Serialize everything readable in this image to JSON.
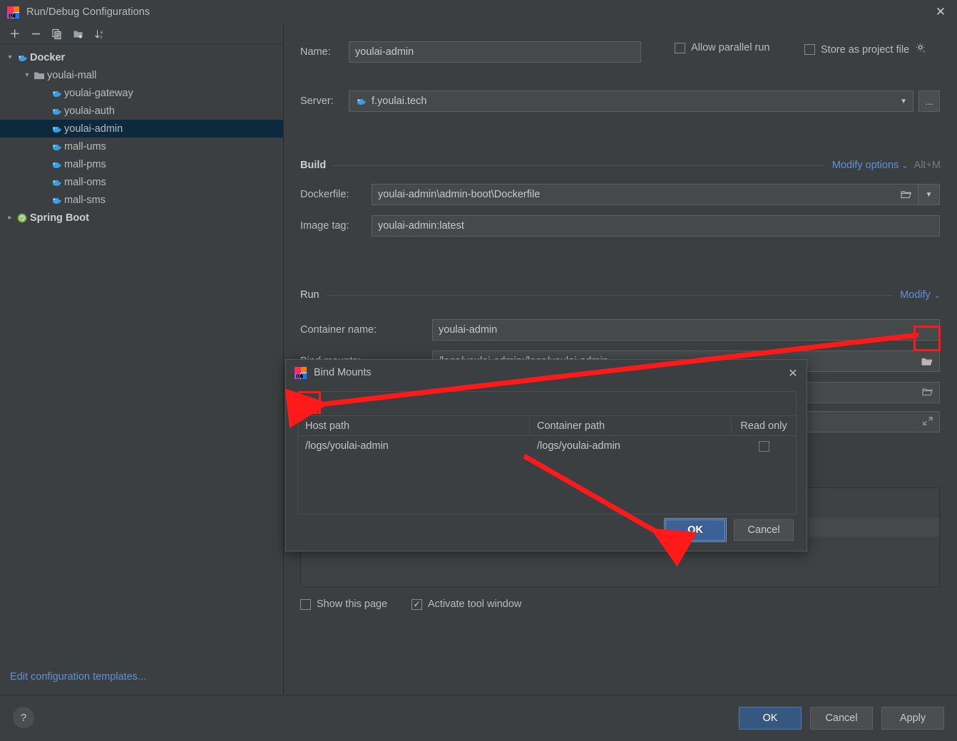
{
  "window": {
    "title": "Run/Debug Configurations",
    "app_icon": "intellij-idea-icon",
    "close_label": "✕"
  },
  "sidebar": {
    "toolbar": [
      {
        "name": "add-configuration-button",
        "icon": "plus-icon",
        "label": "+"
      },
      {
        "name": "remove-configuration-button",
        "icon": "minus-icon",
        "label": "−"
      },
      {
        "name": "copy-configuration-button",
        "icon": "copy-icon",
        "label": ""
      },
      {
        "name": "new-folder-button",
        "icon": "new-folder-icon",
        "label": ""
      },
      {
        "name": "sort-configurations-button",
        "icon": "sort-alphabetically-icon",
        "label": ""
      }
    ],
    "tree": [
      {
        "label": "Docker",
        "icon": "docker-icon",
        "level": 0,
        "expanded": true,
        "bold": true,
        "selected": false
      },
      {
        "label": "youlai-mall",
        "icon": "folder-icon",
        "level": 1,
        "expanded": true,
        "bold": false,
        "selected": false
      },
      {
        "label": "youlai-gateway",
        "icon": "docker-icon",
        "level": 2,
        "expanded": null,
        "bold": false,
        "selected": false
      },
      {
        "label": "youlai-auth",
        "icon": "docker-icon",
        "level": 2,
        "expanded": null,
        "bold": false,
        "selected": false
      },
      {
        "label": "youlai-admin",
        "icon": "docker-icon",
        "level": 2,
        "expanded": null,
        "bold": false,
        "selected": true
      },
      {
        "label": "mall-ums",
        "icon": "docker-icon",
        "level": 2,
        "expanded": null,
        "bold": false,
        "selected": false
      },
      {
        "label": "mall-pms",
        "icon": "docker-icon",
        "level": 2,
        "expanded": null,
        "bold": false,
        "selected": false
      },
      {
        "label": "mall-oms",
        "icon": "docker-icon",
        "level": 2,
        "expanded": null,
        "bold": false,
        "selected": false
      },
      {
        "label": "mall-sms",
        "icon": "docker-icon",
        "level": 2,
        "expanded": null,
        "bold": false,
        "selected": false
      },
      {
        "label": "Spring Boot",
        "icon": "spring-boot-icon",
        "level": 0,
        "expanded": false,
        "bold": true,
        "selected": false
      }
    ],
    "edit_templates_link": "Edit configuration templates..."
  },
  "form": {
    "name_label": "Name:",
    "name_value": "youlai-admin",
    "allow_parallel_run_label": "Allow parallel run",
    "allow_parallel_run_checked": false,
    "store_as_project_file_label": "Store as project file",
    "store_as_project_file_checked": false,
    "store_gear_icon": "gear-icon",
    "server_label": "Server:",
    "server_value": "f.youlai.tech",
    "server_icon": "docker-icon",
    "server_browse_label": "...",
    "build_section_title": "Build",
    "modify_options_link": "Modify options",
    "modify_options_shortcut": "Alt+M",
    "dockerfile_label": "Dockerfile:",
    "dockerfile_value": "youlai-admin\\admin-boot\\Dockerfile",
    "image_tag_label": "Image tag:",
    "image_tag_value": "youlai-admin:latest",
    "run_section_title": "Run",
    "modify_link": "Modify",
    "container_name_label": "Container name:",
    "container_name_value": "youlai-admin",
    "bind_mounts_label": "Bind mounts:",
    "bind_mounts_value": "/logs/youlai-admin:/logs/youlai-admin",
    "bind_mounts_browse_icon": "folder-open-icon",
    "show_this_page_label": "Show this page",
    "show_this_page_checked": false,
    "activate_tool_window_label": "Activate tool window",
    "activate_tool_window_checked": true
  },
  "bind_mounts_dialog": {
    "title": "Bind Mounts",
    "app_icon": "intellij-idea-icon",
    "close_label": "✕",
    "add_button_label": "+",
    "remove_button_label": "−",
    "columns": [
      "Host path",
      "Container path",
      "Read only"
    ],
    "rows": [
      {
        "host_path": "/logs/youlai-admin",
        "container_path": "/logs/youlai-admin",
        "read_only": false
      }
    ],
    "ok_label": "OK",
    "cancel_label": "Cancel"
  },
  "bottom_bar": {
    "help_label": "?",
    "ok_label": "OK",
    "cancel_label": "Cancel",
    "apply_label": "Apply"
  },
  "annotations": {
    "accent_color": "#ff1a1a",
    "highlight_boxes": [
      "bind-mounts-browse-button",
      "bind-mounts-add-button"
    ],
    "arrows": [
      "browse-to-add-arrow",
      "row-to-ok-arrow"
    ]
  },
  "colors": {
    "window_bg": "#3c3f41",
    "field_bg": "#45494a",
    "selection_bg": "#0d293e",
    "link": "#5e92d1",
    "primary_button": "#365880",
    "annotation_red": "#ff1a1a"
  }
}
